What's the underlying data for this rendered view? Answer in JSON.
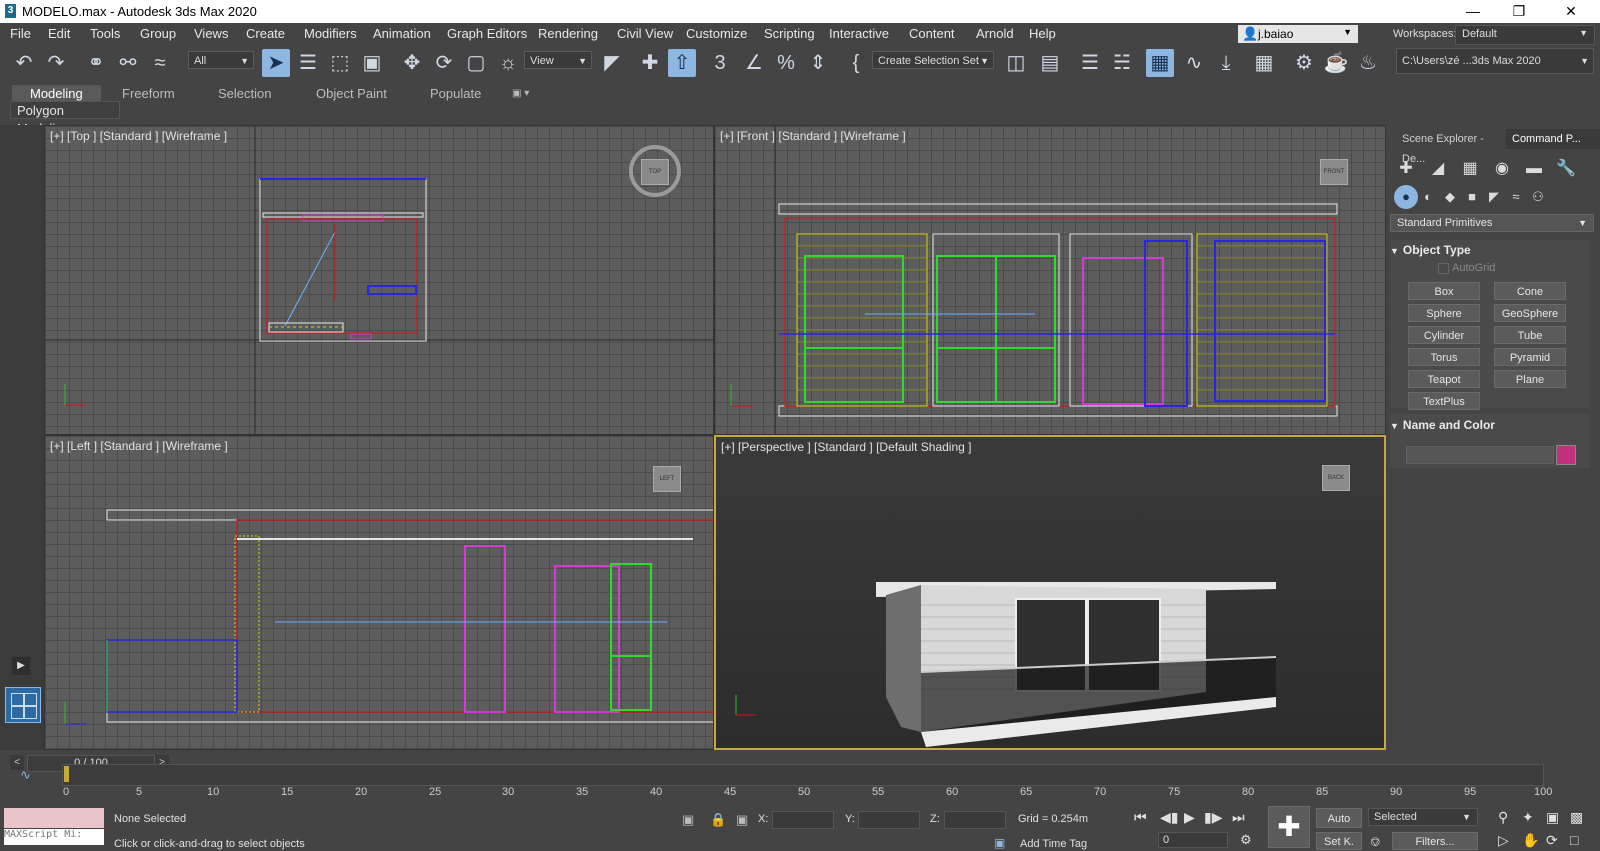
{
  "window": {
    "title": "MODELO.max - Autodesk 3ds Max 2020",
    "app_icon": "3"
  },
  "menu": [
    "File",
    "Edit",
    "Tools",
    "Group",
    "Views",
    "Create",
    "Modifiers",
    "Animation",
    "Graph Editors",
    "Rendering",
    "Civil View",
    "Customize",
    "Scripting",
    "Interactive",
    "Content",
    "Arnold",
    "Help"
  ],
  "user": {
    "name": "j.baiao"
  },
  "workspace": {
    "label": "Workspaces:",
    "value": "Default"
  },
  "toolbar": {
    "filter": "All",
    "coord_system": "View",
    "selection_set": "Create Selection Set",
    "project_path": "C:\\Users\\zé ...3ds Max 2020"
  },
  "ribbon": {
    "tabs": [
      "Modeling",
      "Freeform",
      "Selection",
      "Object Paint",
      "Populate"
    ],
    "active_tab": "Modeling",
    "panel": "Polygon Modeling"
  },
  "viewports": {
    "top": {
      "label": "[+] [Top ] [Standard ] [Wireframe ]",
      "cube": "TOP"
    },
    "front": {
      "label": "[+] [Front ] [Standard ] [Wireframe ]",
      "cube": "FRONT"
    },
    "left": {
      "label": "[+] [Left ] [Standard ] [Wireframe ]",
      "cube": "LEFT"
    },
    "perspective": {
      "label": "[+] [Perspective ] [Standard ] [Default Shading ]",
      "cube": "BACK"
    }
  },
  "command_panel": {
    "tabs": [
      "Scene Explorer - De...",
      "Command P..."
    ],
    "category": "Standard Primitives",
    "object_type": {
      "header": "Object Type",
      "autogrid": "AutoGrid",
      "buttons": [
        "Box",
        "Cone",
        "Sphere",
        "GeoSphere",
        "Cylinder",
        "Tube",
        "Torus",
        "Pyramid",
        "Teapot",
        "Plane",
        "TextPlus"
      ]
    },
    "name_and_color": {
      "header": "Name and Color",
      "name_value": "",
      "color": "#c2317d"
    }
  },
  "timeline": {
    "frame_readout": "0 / 100",
    "ticks": [
      "0",
      "5",
      "10",
      "15",
      "20",
      "25",
      "30",
      "35",
      "40",
      "45",
      "50",
      "55",
      "60",
      "65",
      "70",
      "75",
      "80",
      "85",
      "90",
      "95",
      "100"
    ]
  },
  "status": {
    "selection": "None Selected",
    "prompt": "Click or click-and-drag to select objects",
    "maxscript": "MAXScript Mi:",
    "x_label": "X:",
    "y_label": "Y:",
    "z_label": "Z:",
    "grid": "Grid = 0.254m",
    "add_time_tag": "Add Time Tag",
    "auto": "Auto",
    "set_key": "Set K.",
    "key_filter": "Selected",
    "filters": "Filters...",
    "current_frame": "0"
  },
  "colors": {
    "accent": "#8db7e1",
    "active_viewport_border": "#c7a93a",
    "background": "#444444",
    "viewport": "#5d5d5d"
  }
}
